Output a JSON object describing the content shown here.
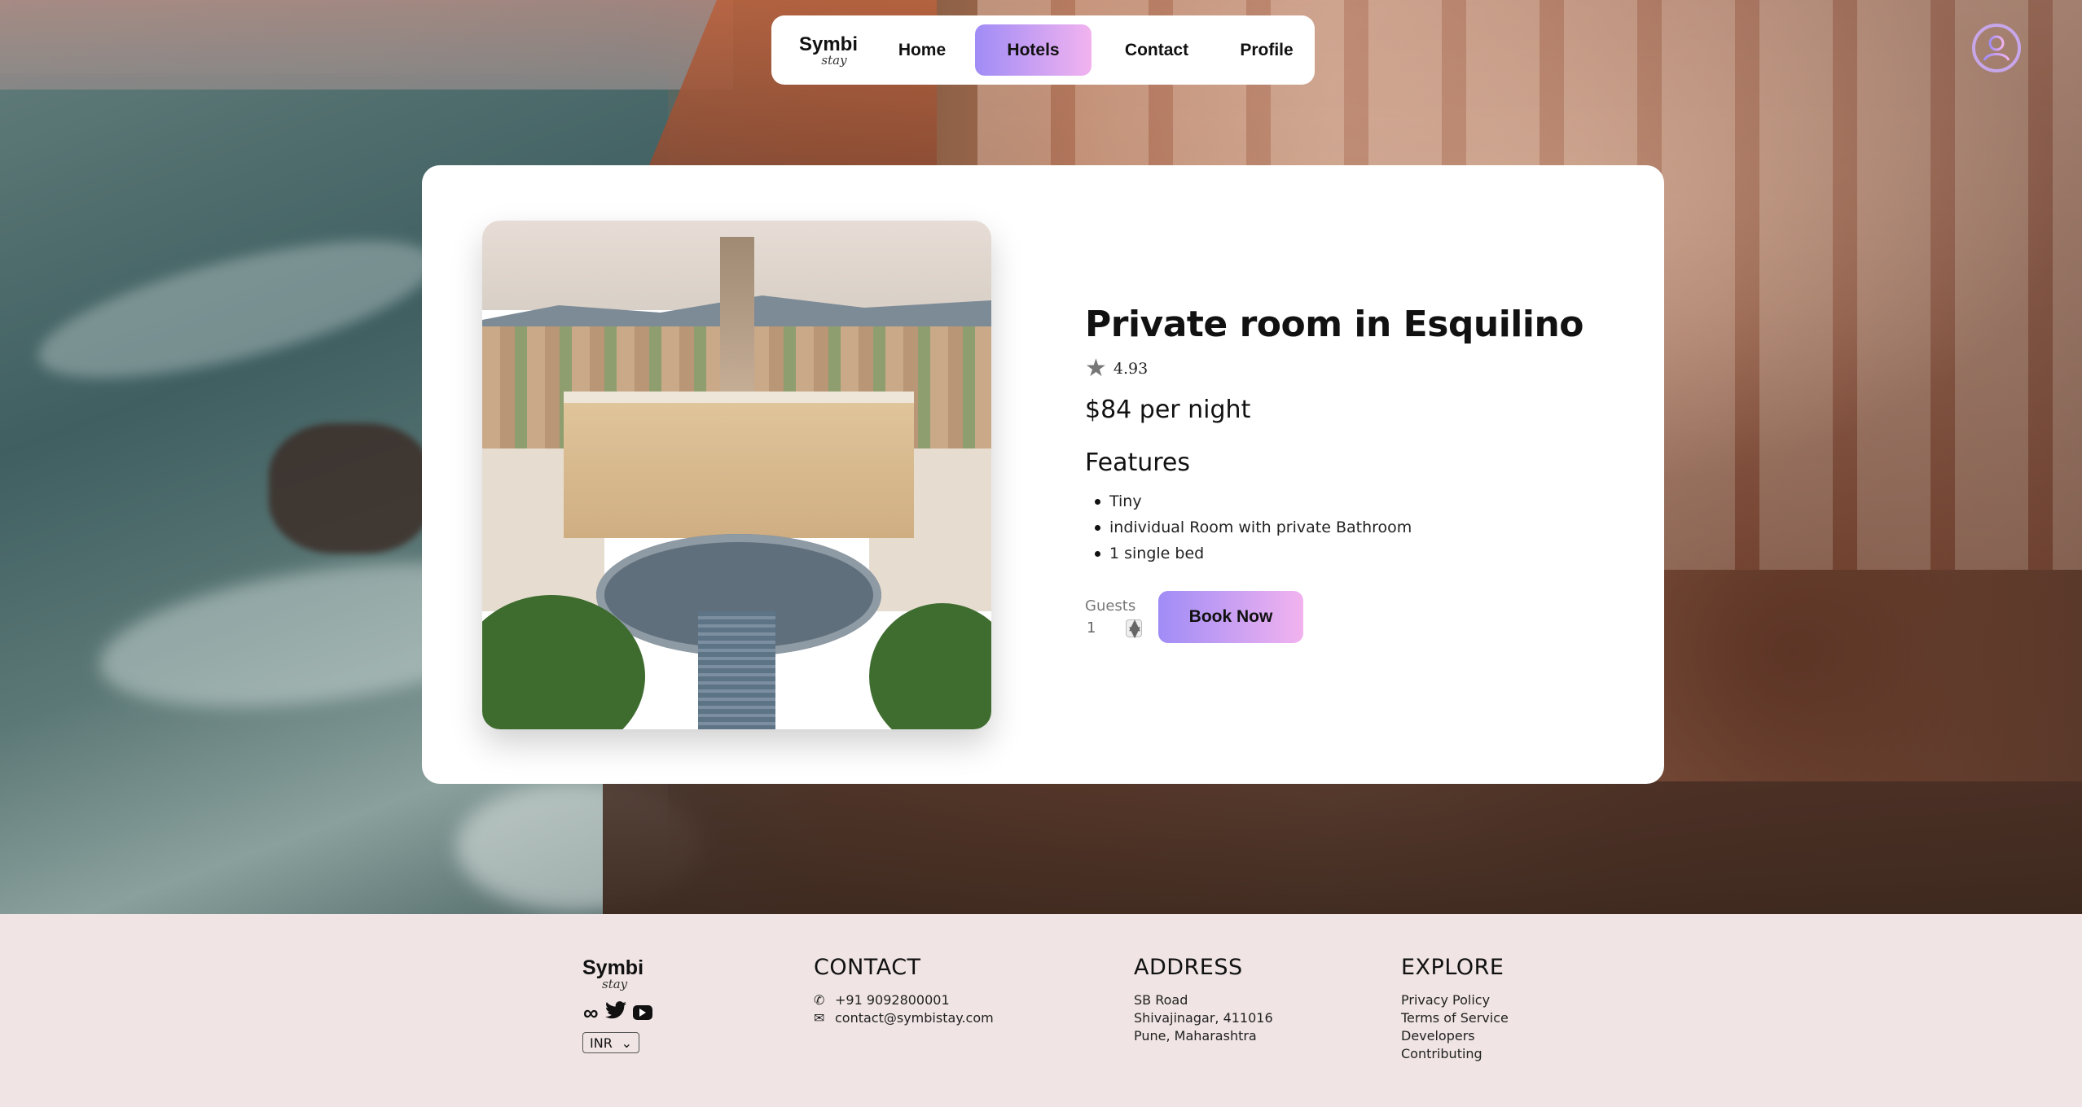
{
  "nav": {
    "logo_top": "Symbi",
    "logo_bottom": "stay",
    "items": [
      {
        "label": "Home"
      },
      {
        "label": "Hotels",
        "active": true
      },
      {
        "label": "Contact"
      },
      {
        "label": "Profile"
      }
    ],
    "avatar_icon": "user-circle-icon",
    "accent_gradient": [
      "#a08cf6",
      "#f2b3ef"
    ]
  },
  "listing": {
    "title": "Private room in Esquilino",
    "star_icon": "star-icon",
    "rating": "4.93",
    "price": "$84 per night",
    "features_heading": "Features",
    "features": [
      "Tiny",
      "individual Room with private Bathroom",
      "1 single bed"
    ],
    "guests_label": "Guests",
    "guests_value": "1",
    "book_label": "Book Now"
  },
  "footer": {
    "logo_top": "Symbi",
    "logo_bottom": "stay",
    "social_icons": [
      "meta-icon",
      "twitter-icon",
      "youtube-icon"
    ],
    "currency": "INR",
    "contact": {
      "heading": "CONTACT",
      "phone": "+91 9092800001",
      "email": "contact@symbistay.com"
    },
    "address": {
      "heading": "ADDRESS",
      "lines": [
        "SB Road",
        "Shivajinagar, 411016",
        "Pune, Maharashtra"
      ]
    },
    "explore": {
      "heading": "EXPLORE",
      "links": [
        "Privacy Policy",
        "Terms of Service",
        "Developers",
        "Contributing"
      ]
    }
  }
}
